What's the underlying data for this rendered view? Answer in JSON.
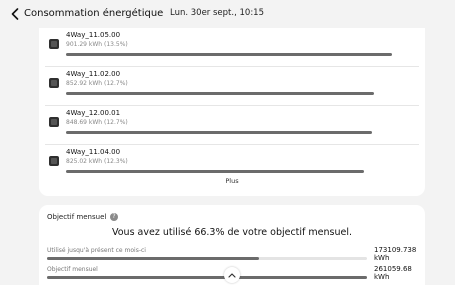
{
  "header": {
    "title": "Consommation énergétique",
    "datetime": "Lun. 30er sept., 10:15"
  },
  "devices": [
    {
      "name": "4Way_11.05.00",
      "value": "901.29 kWh (13.5%)",
      "share": 0.135
    },
    {
      "name": "4Way_11.02.00",
      "value": "852.92 kWh (12.7%)",
      "share": 0.127
    },
    {
      "name": "4Way_12.00.01",
      "value": "848.69 kWh (12.7%)",
      "share": 0.127
    },
    {
      "name": "4Way_11.04.00",
      "value": "825.02 kWh (12.3%)",
      "share": 0.123
    }
  ],
  "more_label": "Plus",
  "goal": {
    "title": "Objectif mensuel",
    "headline": "Vous avez utilisé 66.3% de votre objectif mensuel.",
    "used_label": "Utilisé jusqu'à présent ce mois-ci",
    "used_value": "173109.738",
    "used_unit": "kWh",
    "used_fraction": 0.663,
    "target_label": "Objectif mensuel",
    "target_value": "261059.68",
    "target_unit": "kWh",
    "target_fraction": 1.0
  },
  "icons": {
    "back": "chevron-left-icon",
    "info": "info-icon",
    "scroll_up": "chevron-up-icon",
    "device": "device-icon"
  },
  "colors": {
    "background": "#f3f3f3",
    "card": "#ffffff",
    "bar": "#6b6b6b",
    "bar_track": "#e4e4e4"
  }
}
